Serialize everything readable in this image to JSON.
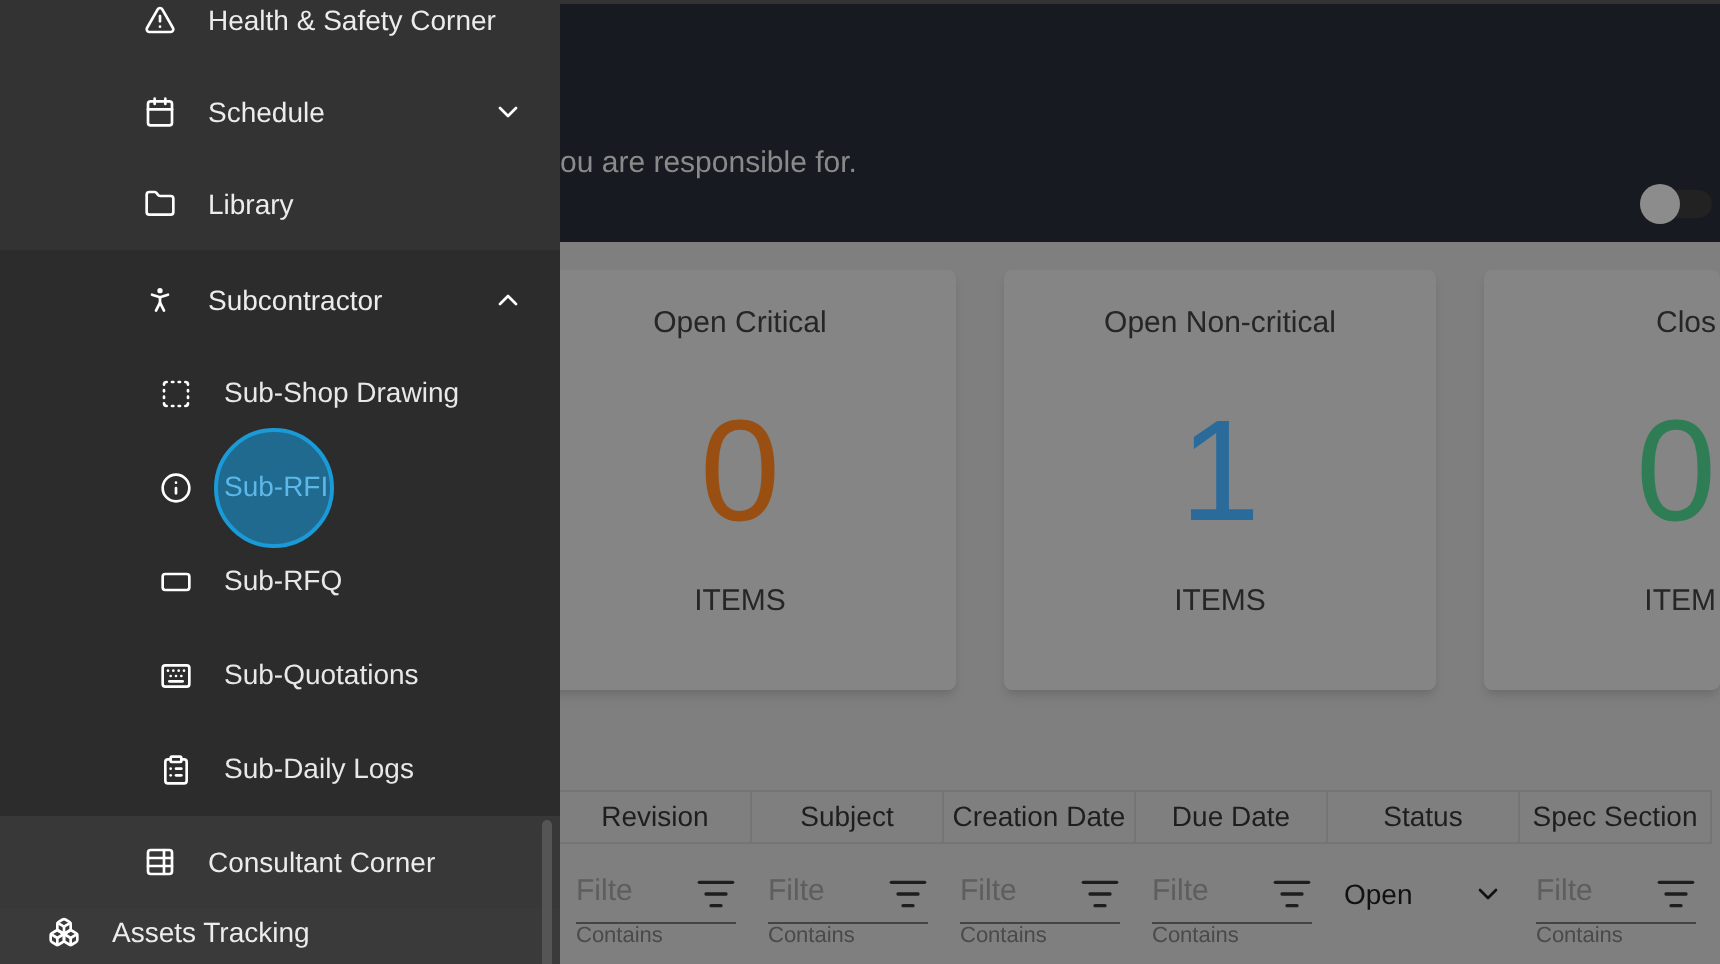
{
  "sidebar": {
    "items": [
      {
        "label": "Health & Safety Corner"
      },
      {
        "label": "Schedule",
        "expanded": false
      },
      {
        "label": "Library"
      },
      {
        "label": "Subcontractor",
        "expanded": true,
        "children": [
          {
            "label": "Sub-Shop Drawing",
            "selected": false
          },
          {
            "label": "Sub-RFI",
            "selected": true
          },
          {
            "label": "Sub-RFQ",
            "selected": false
          },
          {
            "label": "Sub-Quotations",
            "selected": false
          },
          {
            "label": "Sub-Daily Logs",
            "selected": false
          }
        ]
      },
      {
        "label": "Consultant Corner"
      }
    ],
    "next_section": {
      "label": "Assets Tracking"
    }
  },
  "header": {
    "subtitle": "ou are responsible for.",
    "toggle": {
      "on": false
    }
  },
  "cards": [
    {
      "title": "Open Critical",
      "value": "0",
      "caption": "ITEMS",
      "color": "#9a4f12"
    },
    {
      "title": "Open Non-critical",
      "value": "1",
      "caption": "ITEMS",
      "color": "#2b6b9c"
    },
    {
      "title": "Clos",
      "value": "0",
      "caption": "ITEM",
      "color": "#2f7d55"
    }
  ],
  "table": {
    "columns": [
      {
        "label": "Revision",
        "filter": {
          "kind": "text",
          "placeholder": "Filte",
          "mode": "Contains"
        }
      },
      {
        "label": "Subject",
        "filter": {
          "kind": "text",
          "placeholder": "Filte",
          "mode": "Contains"
        }
      },
      {
        "label": "Creation Date",
        "filter": {
          "kind": "text",
          "placeholder": "Filte",
          "mode": "Contains"
        }
      },
      {
        "label": "Due Date",
        "filter": {
          "kind": "text",
          "placeholder": "Filte",
          "mode": "Contains"
        }
      },
      {
        "label": "Status",
        "filter": {
          "kind": "select",
          "value": "Open"
        }
      },
      {
        "label": "Spec Section",
        "filter": {
          "kind": "text",
          "placeholder": "Filte",
          "mode": "Contains"
        }
      }
    ]
  }
}
